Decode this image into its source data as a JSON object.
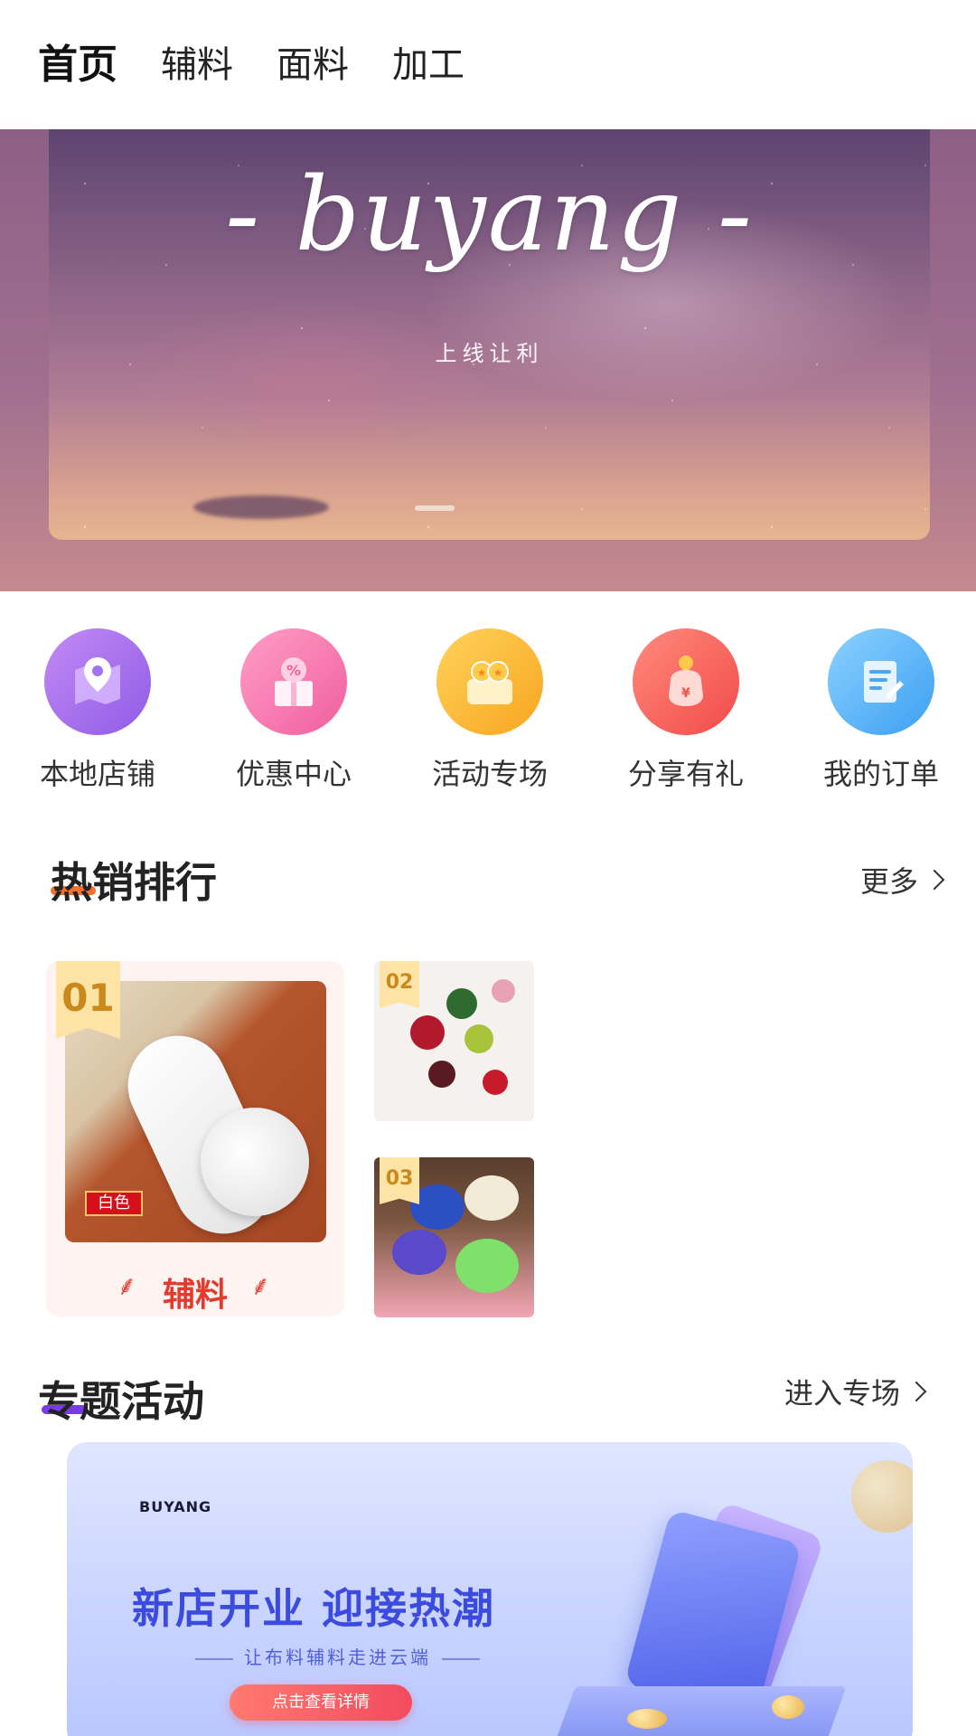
{
  "top_tabs": [
    {
      "label": "首页",
      "active": true
    },
    {
      "label": "辅料",
      "active": false
    },
    {
      "label": "面料",
      "active": false
    },
    {
      "label": "加工",
      "active": false
    }
  ],
  "banner": {
    "logo_text": "- buyang -",
    "subtitle": "上线让利"
  },
  "quick_actions": [
    {
      "label": "本地店铺",
      "icon": "map-pin-icon",
      "color": "#9b63ea"
    },
    {
      "label": "优惠中心",
      "icon": "discount-gift-icon",
      "color": "#f26aa5"
    },
    {
      "label": "活动专场",
      "icon": "coin-wallet-icon",
      "color": "#f9ad25"
    },
    {
      "label": "分享有礼",
      "icon": "money-bag-icon",
      "color": "#f2524c"
    },
    {
      "label": "我的订单",
      "icon": "order-doc-icon",
      "color": "#4aa6f2"
    }
  ],
  "hot_ranking": {
    "title": "热销排行",
    "more_label": "更多",
    "items": [
      {
        "rank": "01",
        "caption": "辅料",
        "tag": "白色"
      },
      {
        "rank": "02"
      },
      {
        "rank": "03"
      }
    ]
  },
  "special_events": {
    "title": "专题活动",
    "more_label": "进入专场",
    "promo": {
      "brand": "BUYANG",
      "headline": "新店开业 迎接热潮",
      "subline": "让布料辅料走进云端",
      "button_label": "点击查看详情"
    }
  },
  "colors": {
    "accent_red": "#e23b2e",
    "promo_blue": "#3b4be0",
    "rank_badge": "#fde3a6"
  }
}
